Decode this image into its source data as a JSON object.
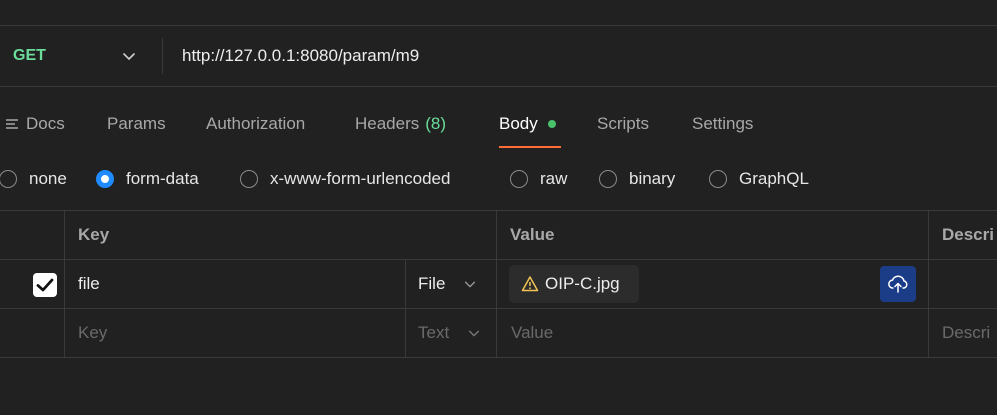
{
  "request": {
    "method": "GET",
    "url": "http://127.0.0.1:8080/param/m9"
  },
  "tabs": {
    "docs": "Docs",
    "params": "Params",
    "authorization": "Authorization",
    "headers": "Headers",
    "headers_count": "(8)",
    "body": "Body",
    "scripts": "Scripts",
    "settings": "Settings"
  },
  "body_types": {
    "none": "none",
    "form_data": "form-data",
    "urlencoded": "x-www-form-urlencoded",
    "raw": "raw",
    "binary": "binary",
    "graphql": "GraphQL",
    "selected": "form-data"
  },
  "table": {
    "headers": {
      "key": "Key",
      "value": "Value",
      "description": "Descri"
    },
    "rows": [
      {
        "checked": true,
        "key": "file",
        "type": "File",
        "value": "OIP-C.jpg"
      }
    ],
    "new_row": {
      "key_placeholder": "Key",
      "type": "Text",
      "value_placeholder": "Value",
      "description_placeholder": "Descri"
    }
  },
  "colors": {
    "accent": "#ff6c37",
    "method": "#6bdd9a",
    "radio_selected": "#1f8bff",
    "upload_button": "#1b3d87"
  }
}
